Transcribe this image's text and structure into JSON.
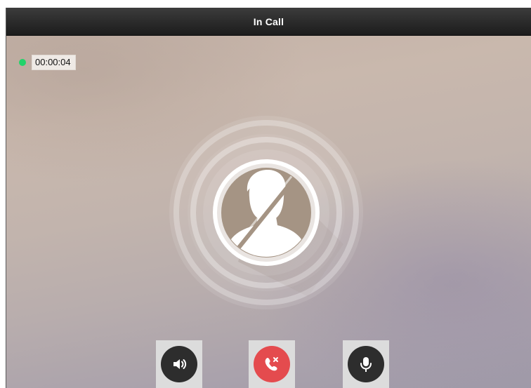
{
  "window": {
    "title": "In Call"
  },
  "call": {
    "status_indicator_color": "#22d36a",
    "duration": "00:00:04",
    "avatar_icon": "user-avatar-muted-icon"
  },
  "controls": [
    {
      "name": "speaker",
      "icon": "speaker-icon",
      "color": "#2d2d2d"
    },
    {
      "name": "hang-up",
      "icon": "phone-hangup-icon",
      "color": "#e44b4e"
    },
    {
      "name": "microphone",
      "icon": "microphone-icon",
      "color": "#2d2d2d"
    }
  ]
}
